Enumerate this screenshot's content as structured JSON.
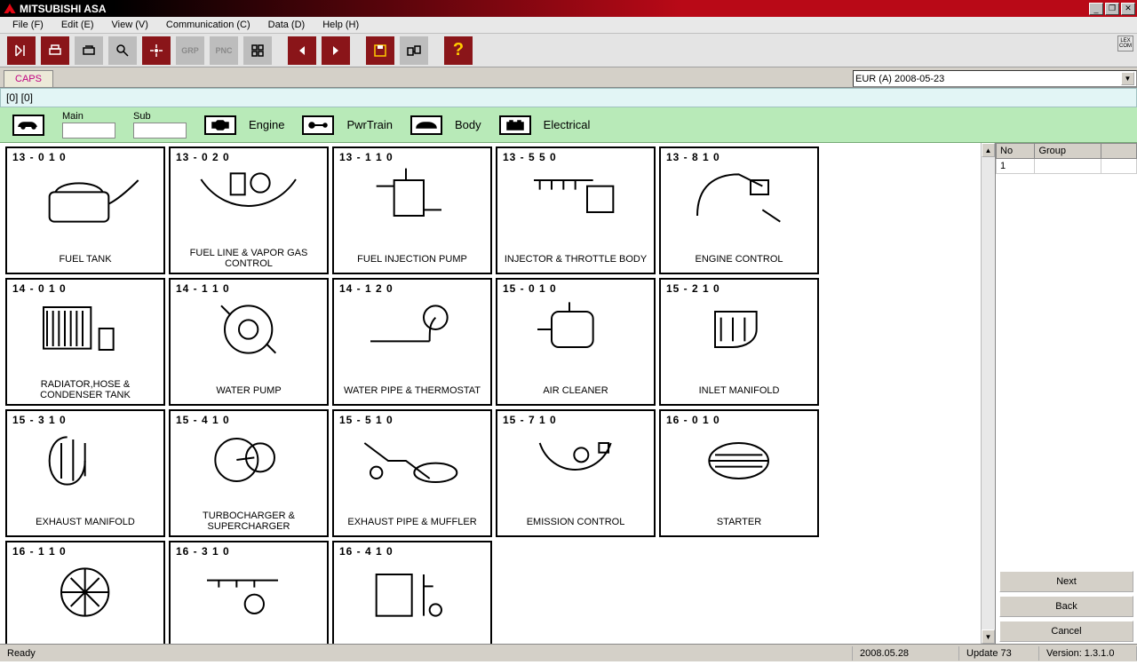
{
  "title": "MITSUBISHI ASA",
  "menu": [
    "File (F)",
    "Edit (E)",
    "View (V)",
    "Communication (C)",
    "Data (D)",
    "Help (H)"
  ],
  "tab": "CAPS",
  "region_combo": "EUR (A)   2008-05-23",
  "infoline": "[0] [0]",
  "filter": {
    "main_label": "Main",
    "sub_label": "Sub",
    "main_value": "",
    "sub_value": "",
    "categories": [
      "Engine",
      "PwrTrain",
      "Body",
      "Electrical"
    ]
  },
  "parts": [
    {
      "code": "13-010",
      "label": "FUEL TANK"
    },
    {
      "code": "13-020",
      "label": "FUEL LINE & VAPOR GAS CONTROL"
    },
    {
      "code": "13-110",
      "label": "FUEL INJECTION PUMP"
    },
    {
      "code": "13-550",
      "label": "INJECTOR & THROTTLE BODY"
    },
    {
      "code": "13-810",
      "label": "ENGINE CONTROL"
    },
    {
      "code": "14-010",
      "label": "RADIATOR,HOSE & CONDENSER TANK"
    },
    {
      "code": "14-110",
      "label": "WATER PUMP"
    },
    {
      "code": "14-120",
      "label": "WATER PIPE & THERMOSTAT"
    },
    {
      "code": "15-010",
      "label": "AIR CLEANER"
    },
    {
      "code": "15-210",
      "label": "INLET MANIFOLD"
    },
    {
      "code": "15-310",
      "label": "EXHAUST MANIFOLD"
    },
    {
      "code": "15-410",
      "label": "TURBOCHARGER & SUPERCHARGER"
    },
    {
      "code": "15-510",
      "label": "EXHAUST PIPE & MUFFLER"
    },
    {
      "code": "15-710",
      "label": "EMISSION CONTROL"
    },
    {
      "code": "16-010",
      "label": "STARTER"
    },
    {
      "code": "16-110",
      "label": ""
    },
    {
      "code": "16-310",
      "label": ""
    },
    {
      "code": "16-410",
      "label": ""
    }
  ],
  "side_table": {
    "headers": [
      "No",
      "Group"
    ],
    "rows": [
      [
        "1",
        ""
      ]
    ]
  },
  "buttons": {
    "next": "Next",
    "back": "Back",
    "cancel": "Cancel"
  },
  "status": {
    "ready": "Ready",
    "date": "2008.05.28",
    "update": "Update 73",
    "version": "Version: 1.3.1.0"
  },
  "lexcom": "LEX COM"
}
